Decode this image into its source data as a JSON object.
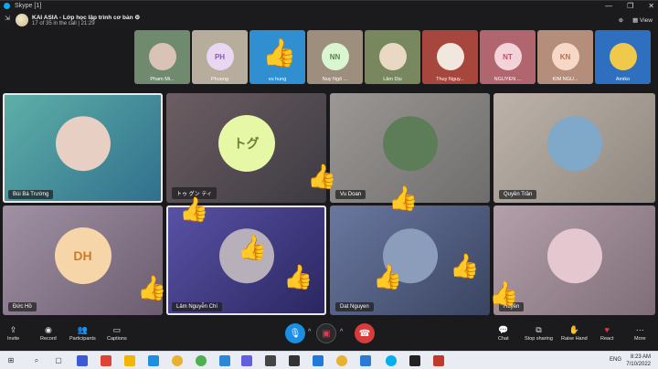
{
  "window": {
    "title": "Skype [1]",
    "controls": [
      "—",
      "❐",
      "✕"
    ]
  },
  "header": {
    "group_name": "KAI ASIA - Lớp học lập trình cơ bản",
    "subtitle": "17 of 35 in the call | 21:29",
    "view_label": "View"
  },
  "strip": [
    {
      "name": "Pham Mi...",
      "initials": "",
      "bg": "#6f8a6f",
      "avatar": "#d9c3b6"
    },
    {
      "name": "Phuong",
      "initials": "PH",
      "bg": "#b6ad9d",
      "avatar": "#e8d6f3"
    },
    {
      "name": "vu hung",
      "initials": "",
      "bg": "#2f8fd0",
      "avatar": ""
    },
    {
      "name": "Nuy Ngô ...",
      "initials": "NN",
      "bg": "#9e8e7d",
      "avatar": "#d9f5d1"
    },
    {
      "name": "Lâm Dịu",
      "initials": "",
      "bg": "#79875f",
      "avatar": "#e9d9c4"
    },
    {
      "name": "Thuy Nguy...",
      "initials": "",
      "bg": "#a7463d",
      "avatar": "#f1e7df"
    },
    {
      "name": "NGUYỄN ...",
      "initials": "NT",
      "bg": "#b0656f",
      "avatar": "#f4d2d9"
    },
    {
      "name": "KIM NGU...",
      "initials": "KN",
      "bg": "#b58d7b",
      "avatar": "#f7d8c7"
    },
    {
      "name": "Amiko",
      "initials": "",
      "bg": "#2e6fbf",
      "avatar": "#f0c94a"
    }
  ],
  "tiles": [
    {
      "name": "Bùi Bá Trường",
      "initials": "",
      "bg": "#4c9b95",
      "avatar": "#e7cfc4"
    },
    {
      "name": "トゥ グン ティ",
      "initials": "トグ",
      "bg": "#6c5e63",
      "avatar": "#e6f7a6"
    },
    {
      "name": "Vu Doan",
      "initials": "",
      "bg": "#8a8886",
      "avatar": "#5d7c58"
    },
    {
      "name": "Quyền Trần",
      "initials": "",
      "bg": "#a69e96",
      "avatar": "#7fa8c9"
    },
    {
      "name": "Đức Hồ",
      "initials": "DH",
      "bg": "#8d7d8f",
      "avatar": "#f6d6a8"
    },
    {
      "name": "Lâm Nguyễn Chí",
      "initials": "",
      "bg": "#463f8a",
      "avatar": "#b7b0ba"
    },
    {
      "name": "Dat Nguyen",
      "initials": "",
      "bg": "#4f5d7e",
      "avatar": "#8b9dbb"
    },
    {
      "name": "Huyền",
      "initials": "",
      "bg": "#9f8c97",
      "avatar": "#e4c7cf"
    }
  ],
  "toolbar": {
    "invite": "Invite",
    "record": "Record",
    "participants": "Participants",
    "captions": "Captions",
    "chat": "Chat",
    "stop_sharing": "Stop sharing",
    "raise_hand": "Raise Hand",
    "react": "React",
    "more": "More"
  },
  "taskbar": {
    "lang": "ENG",
    "time": "8:23 AM",
    "date": "7/10/2022"
  },
  "colors": {
    "mic_active": "#1a8fe3",
    "hangup": "#d83b3b",
    "react_heart": "#e8384f"
  }
}
